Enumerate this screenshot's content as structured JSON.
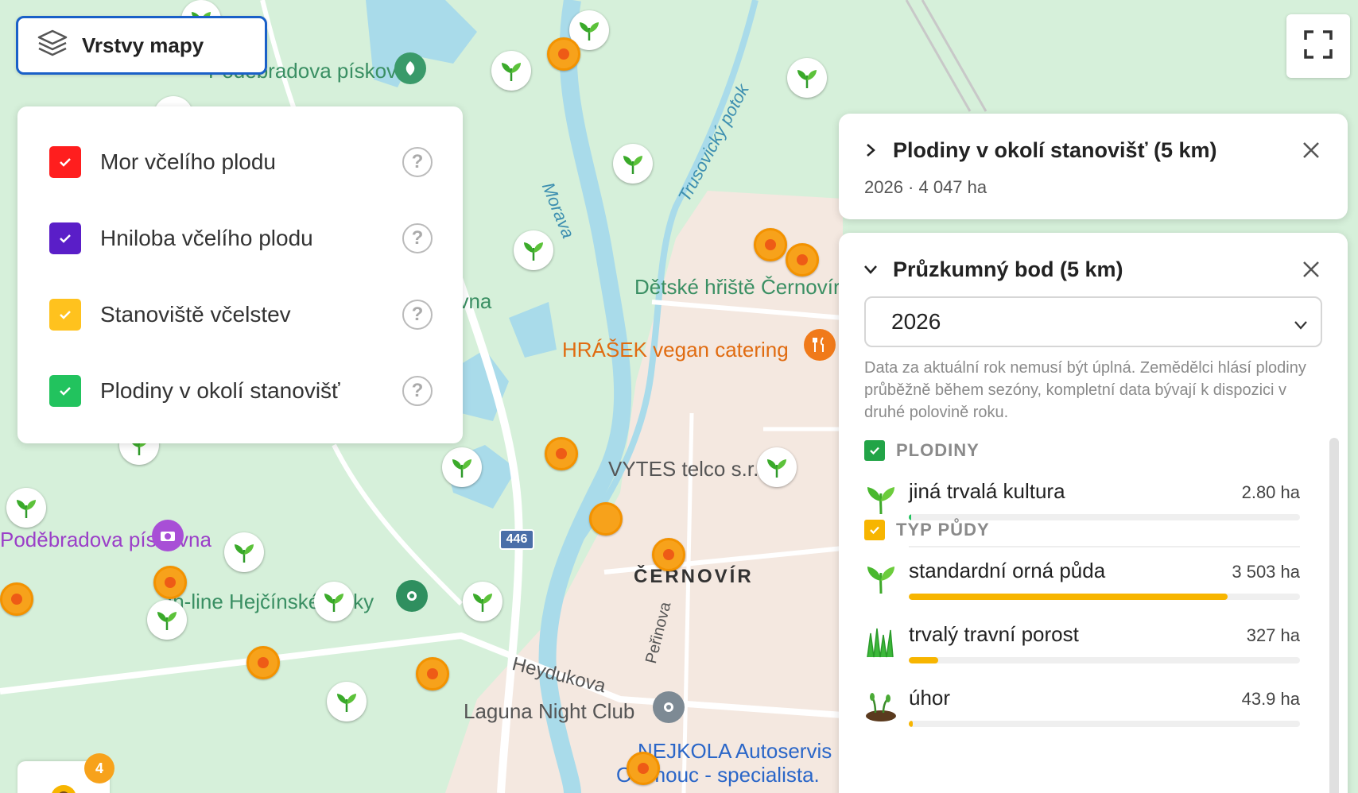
{
  "map": {
    "labels": {
      "piskovna_top": "Poděbradova pískovna",
      "piskovna_left": "Poděbradova pískovna",
      "piskovna_mid": "ovna",
      "morava": "Morava",
      "trusovicky": "Trusovický potok",
      "detske_hriste": "Dětské hřiště Černovír",
      "hrasek": "HRÁŠEK vegan catering",
      "vytes": "VYTES telco s.r.o.",
      "cernovir": "ČERNOVÍR",
      "road_446": "446",
      "inline": "In-line Hejčínské louky",
      "heydukova": "Heydukova",
      "perinova": "Peřinova",
      "laguna": "Laguna Night Club",
      "nejkola_1": "NEJKOLA Autoservis",
      "nejkola_2": "Olomouc - specialista."
    },
    "cluster_badge": "4",
    "colors": {
      "meadow": "#d6f0da",
      "urban": "#f4e8e0",
      "water": "#a9dbea",
      "road": "#ffffff",
      "hive": "#f7a21b",
      "crop_green": "#34b233"
    }
  },
  "layers_button": {
    "label": "Vrstvy mapy",
    "icon": "layers-icon"
  },
  "fullscreen_button": {
    "icon": "fullscreen-icon"
  },
  "layers_panel": {
    "items": [
      {
        "label": "Mor včelího plodu",
        "color": "#ff1e1e",
        "checked": true
      },
      {
        "label": "Hniloba včelího plodu",
        "color": "#5a1ec8",
        "checked": true
      },
      {
        "label": "Stanoviště včelstev",
        "color": "#ffc21e",
        "checked": true
      },
      {
        "label": "Plodiny v okolí stanovišť",
        "color": "#22c35e",
        "checked": true
      }
    ],
    "help_glyph": "?"
  },
  "card_crops": {
    "title": "Plodiny v okolí stanovišť (5 km)",
    "subtitle": "2026 · 4 047 ha"
  },
  "card_survey": {
    "title": "Průzkumný bod (5 km)",
    "year_select": {
      "value": "2026"
    },
    "note": "Data za aktuální rok nemusí být úplná. Zemědělci hlásí plodiny průběžně během sezóny, kompletní data bývají k dispozici v druhé polovině roku.",
    "sections": [
      {
        "heading": "PLODINY",
        "color": "#22a447",
        "rows": [
          {
            "name": "jiná trvalá kultura",
            "value": "2.80 ha",
            "fraction": 0.0007,
            "color": "#22c35e",
            "icon": "seedling-icon"
          }
        ]
      },
      {
        "heading": "TYP PŮDY",
        "color": "#f7b500",
        "rows": [
          {
            "name": "standardní orná půda",
            "value": "3 503 ha",
            "fraction": 0.815,
            "color": "#f7b500",
            "icon": "seedling-icon"
          },
          {
            "name": "trvalý travní porost",
            "value": "327 ha",
            "fraction": 0.076,
            "color": "#f7b500",
            "icon": "grass-icon"
          },
          {
            "name": "úhor",
            "value": "43.9 ha",
            "fraction": 0.01,
            "color": "#f7b500",
            "icon": "fallow-icon"
          }
        ]
      }
    ]
  }
}
